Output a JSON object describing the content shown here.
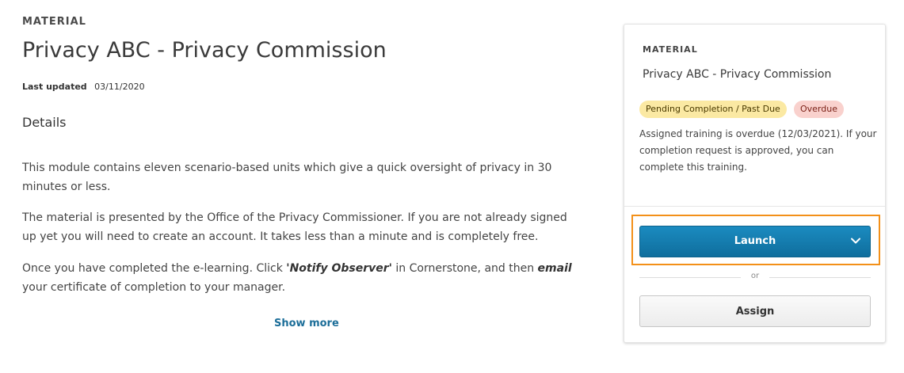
{
  "main": {
    "eyebrow": "MATERIAL",
    "title": "Privacy ABC - Privacy Commission",
    "last_updated_label": "Last updated",
    "last_updated_value": "03/11/2020",
    "details_heading": "Details",
    "paragraph_1": "This module contains eleven scenario-based units which give a quick oversight of privacy in 30 minutes or less.",
    "paragraph_2": "The material is presented by the Office of the Privacy Commissioner. If you are not already signed up yet you will need to create an account. It takes less than a minute and is completely free.",
    "paragraph_3_a": "Once you have completed the e-learning. Click ",
    "paragraph_3_b": "'Notify Observer'",
    "paragraph_3_c": " in Cornerstone, and then ",
    "paragraph_3_d": "email",
    "paragraph_3_e": " your certificate of completion to your manager.",
    "show_more": "Show more"
  },
  "card": {
    "eyebrow": "MATERIAL",
    "title": "Privacy ABC - Privacy Commission",
    "badge_pending": "Pending Completion / Past Due",
    "badge_overdue": "Overdue",
    "message": "Assigned training is overdue (12/03/2021). If your completion request is approved, you can complete this training.",
    "launch_label": "Launch",
    "or_label": "or",
    "assign_label": "Assign"
  },
  "colors": {
    "accent": "#1b8bc0",
    "focus": "#f39019",
    "pending_badge": "#fbe9a3",
    "overdue_badge": "#f9d1cd",
    "link": "#1c6e99"
  },
  "icons": {
    "launch_dropdown": "chevron-down-icon"
  }
}
